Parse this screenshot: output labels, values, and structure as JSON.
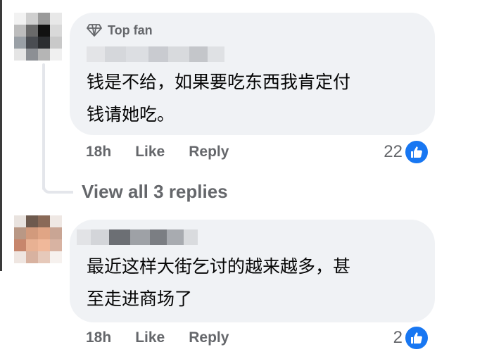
{
  "comments": [
    {
      "badge": "Top fan",
      "badge_icon": "diamond-icon",
      "text_line1": "钱是不给，如果要吃东西我肯定付",
      "text_line2": "钱请她吃。",
      "time": "18h",
      "like_label": "Like",
      "reply_label": "Reply",
      "reaction_count": "22",
      "reaction_icon": "thumbs-up-icon"
    },
    {
      "text_line1": "最近这样大街乞讨的越来越多，甚",
      "text_line2": "至走进商场了",
      "time": "18h",
      "like_label": "Like",
      "reply_label": "Reply",
      "reaction_count": "2",
      "reaction_icon": "thumbs-up-icon"
    }
  ],
  "view_replies": "View all 3 replies",
  "colors": {
    "bubble": "#f0f2f5",
    "meta_text": "#65676b",
    "like_blue": "#1877f2"
  }
}
